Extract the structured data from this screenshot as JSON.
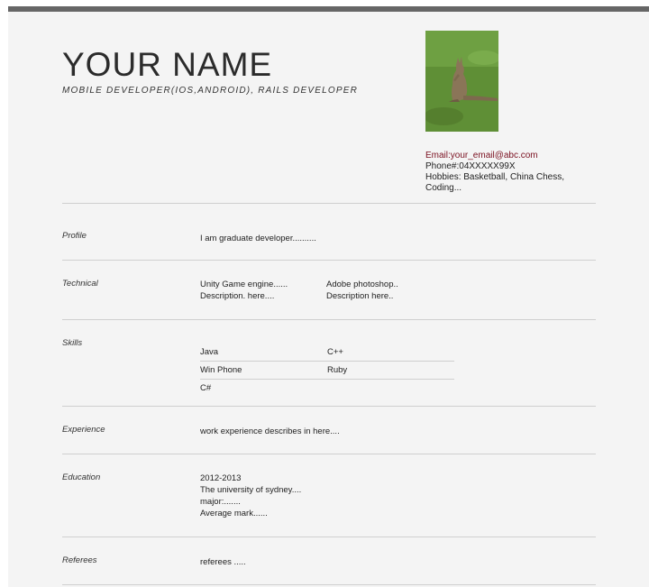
{
  "header": {
    "name": "YOUR NAME",
    "subtitle": "MOBILE DEVELOPER(IOS,ANDROID), RAILS DEVELOPER"
  },
  "contact": {
    "email": "Email:your_email@abc.com",
    "phone": "Phone#:04XXXXX99X",
    "hobbies_line1": "Hobbies: Basketball, China Chess,",
    "hobbies_line2": "Coding..."
  },
  "sections": {
    "profile": {
      "label": "Profile",
      "text": "I am graduate developer.........."
    },
    "technical": {
      "label": "Technical",
      "items": [
        {
          "title": "Unity Game engine......",
          "desc": "Description.  here...."
        },
        {
          "title": "Adobe photoshop..",
          "desc": "Description here.."
        }
      ]
    },
    "skills": {
      "label": "Skills",
      "rows": [
        [
          "Java",
          "C++"
        ],
        [
          "Win Phone",
          "Ruby"
        ],
        [
          "C#",
          ""
        ]
      ]
    },
    "experience": {
      "label": "Experience",
      "text": "work experience describes in here...."
    },
    "education": {
      "label": "Education",
      "lines": [
        "2012-2013",
        "The university of sydney....",
        "major:.......",
        "Average mark......"
      ]
    },
    "referees": {
      "label": "Referees",
      "text": "referees ....."
    }
  },
  "colors": {
    "top_bar": "#666666",
    "page_bg": "#f4f4f4",
    "email": "#7a1020",
    "divider": "#cfcfcf"
  }
}
